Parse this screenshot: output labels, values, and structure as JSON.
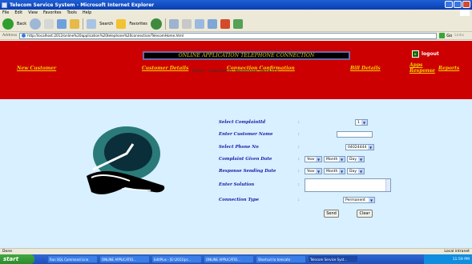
{
  "window": {
    "title": "Telecom Service System - Microsoft Internet Explorer"
  },
  "menu": [
    "File",
    "Edit",
    "View",
    "Favorites",
    "Tools",
    "Help"
  ],
  "toolbar": {
    "back_label": "Back",
    "search_label": "Search",
    "favorites_label": "Favorites"
  },
  "address": {
    "label": "Address",
    "url": "http://localhost:2012/online%20application%20telephone%20connection/TelecomHome.html",
    "go_label": "Go",
    "links_label": "Links"
  },
  "header": {
    "banner": "ONLINE APPLICATION TELEPHONE CONNECTION",
    "logout": "logout",
    "nav": {
      "new_customer": "New Customer",
      "customer_details": "Customer Details",
      "connection_confirmation": "Connection Confirmation",
      "bill_details": "Bill Details",
      "apps_response": "Apps Response",
      "reports": "Reports"
    }
  },
  "form": {
    "title": "Enter Complaint Response Details",
    "colon": ":",
    "labels": {
      "complaint_id": "Select ComplaintId",
      "customer_name": "Enter Customer Name",
      "phone_no": "Select Phone No",
      "given_date": "Complaint Given Date",
      "sending_date": "Response Sending Date",
      "solution": "Enter Solution",
      "connection_type": "Connection Type"
    },
    "values": {
      "complaint_id": "1",
      "phone_no": "04024444",
      "year": "Year",
      "month": "Month",
      "day": "Day",
      "connection_type": "Permanent"
    },
    "buttons": {
      "send": "Send",
      "clear": "Clear"
    }
  },
  "status": {
    "left": "Done",
    "right": "Local intranet"
  },
  "taskbar": {
    "start": "start",
    "tasks": [
      "Run SQL Command Line",
      "ONLINE APPLICATIO...",
      "EditPlus - [E:\\2011\\pr...",
      "ONLINE APPLICATIO...",
      "Shortcut to tomcate",
      "Telecom Service Syst..."
    ],
    "clock": "11:59 PM"
  },
  "colors": {
    "header_red": "#cc0000",
    "link_yellow": "#f5d400",
    "label_blue": "#1a1aa8",
    "page_bg": "#d8f0ff"
  }
}
